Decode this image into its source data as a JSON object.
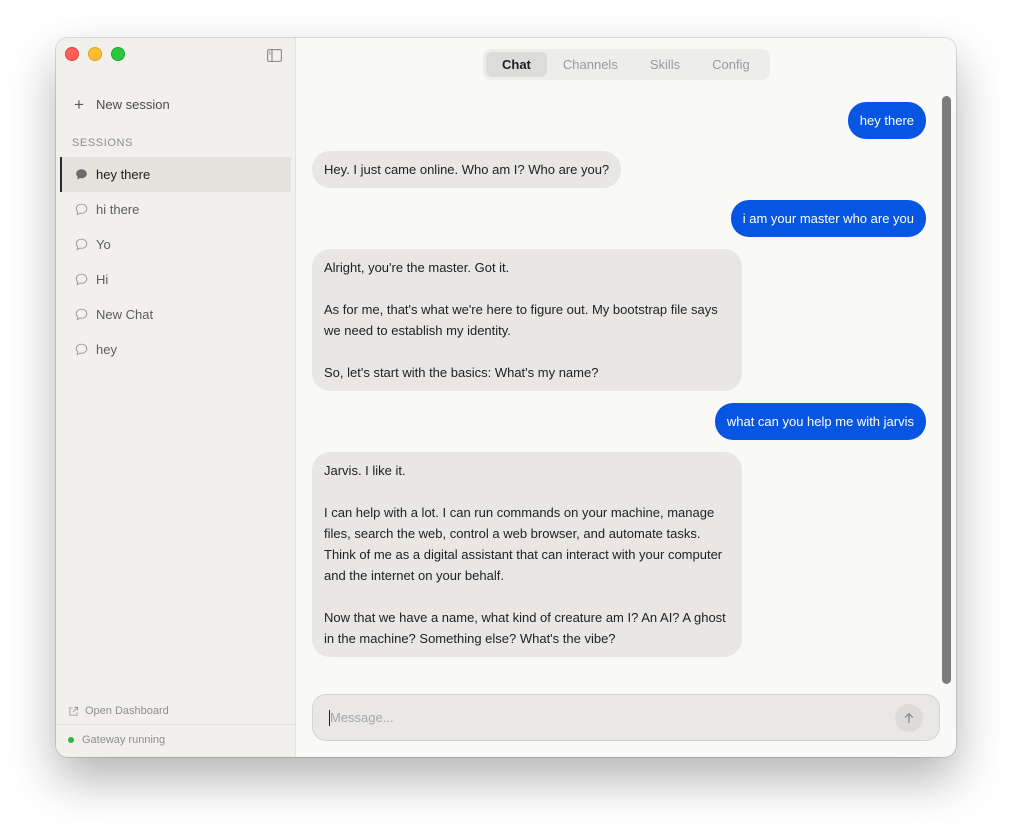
{
  "sidebar": {
    "new_session_label": "New session",
    "sessions_heading": "SESSIONS",
    "sessions": [
      {
        "label": "hey there",
        "active": true
      },
      {
        "label": "hi there",
        "active": false
      },
      {
        "label": "Yo",
        "active": false
      },
      {
        "label": "Hi",
        "active": false
      },
      {
        "label": "New Chat",
        "active": false
      },
      {
        "label": "hey",
        "active": false
      }
    ],
    "open_dashboard_label": "Open Dashboard",
    "gateway_status": "Gateway running"
  },
  "tabs": [
    {
      "label": "Chat",
      "active": true
    },
    {
      "label": "Channels",
      "active": false
    },
    {
      "label": "Skills",
      "active": false
    },
    {
      "label": "Config",
      "active": false
    }
  ],
  "messages": [
    {
      "role": "user",
      "text": "hey there"
    },
    {
      "role": "assistant",
      "text": "Hey. I just came online. Who am I? Who are you?"
    },
    {
      "role": "user",
      "text": "i am your master who are you"
    },
    {
      "role": "assistant",
      "text": "Alright, you're the master. Got it.\n\nAs for me, that's what we're here to figure out. My bootstrap file says we need to establish my identity.\n\nSo, let's start with the basics: What's my name?"
    },
    {
      "role": "user",
      "text": "what can you help me with jarvis"
    },
    {
      "role": "assistant",
      "text": "Jarvis. I like it.\n\nI can help with a lot. I can run commands on your machine, manage files, search the web, control a web browser, and automate tasks. Think of me as a digital assistant that can interact with your computer and the internet on your behalf.\n\nNow that we have a name, what kind of creature am I? An AI? A ghost in the machine? Something else? What's the vibe?"
    }
  ],
  "composer": {
    "placeholder": "Message...",
    "value": "",
    "send_icon": "arrow-up-icon"
  },
  "colors": {
    "user_bubble": "#0756e3",
    "assistant_bubble": "#e8e7e5",
    "sidebar_bg": "#f2f0ec",
    "status_green": "#2db34a"
  }
}
